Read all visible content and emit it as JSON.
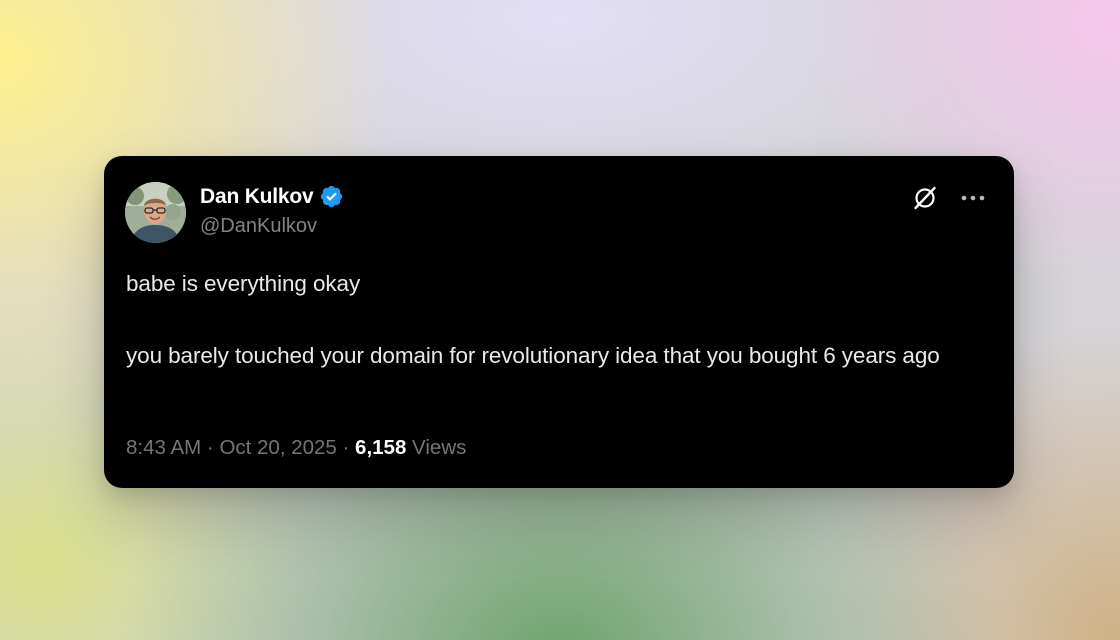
{
  "tweet": {
    "author": {
      "name": "Dan Kulkov",
      "handle": "@DanKulkov",
      "verified": true,
      "verified_color": "#1d9bf0"
    },
    "body": {
      "line1": "babe is everything okay",
      "line2": "you barely touched your domain for revolutionary idea that you bought 6 years ago"
    },
    "meta": {
      "time": "8:43 AM",
      "separator1": " · ",
      "date": "Oct 20, 2025",
      "separator2": " · ",
      "views_count": "6,158",
      "views_label": " Views"
    },
    "icons": {
      "unlink": "unlink-icon",
      "more": "more-horizontal-icon"
    }
  },
  "colors": {
    "card_bg": "#000000",
    "primary_text": "#e7e9ea",
    "secondary_text": "#71767b"
  }
}
